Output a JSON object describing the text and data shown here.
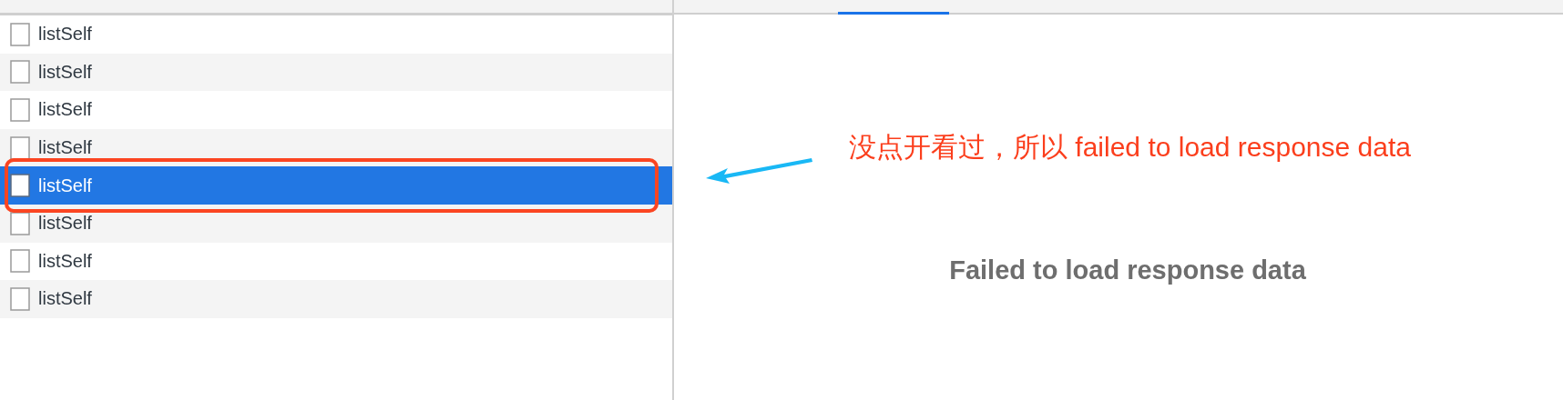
{
  "requests": [
    {
      "name": "listSelf",
      "selected": false
    },
    {
      "name": "listSelf",
      "selected": false
    },
    {
      "name": "listSelf",
      "selected": false
    },
    {
      "name": "listSelf",
      "selected": false
    },
    {
      "name": "listSelf",
      "selected": true
    },
    {
      "name": "listSelf",
      "selected": false
    },
    {
      "name": "listSelf",
      "selected": false
    },
    {
      "name": "listSelf",
      "selected": false
    }
  ],
  "annotation": {
    "text": "没点开看过，所以 failed to load response data"
  },
  "preview": {
    "message": "Failed to load response data"
  }
}
